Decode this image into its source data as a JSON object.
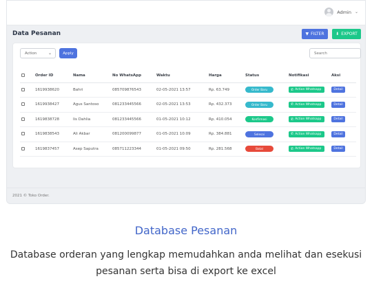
{
  "header": {
    "user_name": "Admin",
    "user_chevron": "⌄"
  },
  "page": {
    "title": "Data Pesanan",
    "filter_label": "FILTER",
    "export_label": "EXPORT"
  },
  "toolbar": {
    "action_value": "Action",
    "apply_label": "Apply",
    "search_placeholder": "Search"
  },
  "table": {
    "columns": [
      "Order ID",
      "Nama",
      "No WhatsApp",
      "Waktu",
      "Harga",
      "Status",
      "Notifikasi",
      "Aksi"
    ],
    "rows": [
      {
        "order_id": "1619938620",
        "nama": "Bahri",
        "wa": "085709876543",
        "waktu": "02-05-2021 13:57",
        "harga": "Rp. 63.749",
        "status": "Order Baru",
        "notif": "Action Whatsapp",
        "aksi": "Detail"
      },
      {
        "order_id": "1619938427",
        "nama": "Agus Santoso",
        "wa": "081233445566",
        "waktu": "02-05-2021 13:53",
        "harga": "Rp. 432.373",
        "status": "Order Baru",
        "notif": "Action Whatsapp",
        "aksi": "Detail"
      },
      {
        "order_id": "1619838728",
        "nama": "Iis Dahlia",
        "wa": "081233445566",
        "waktu": "01-05-2021 10:12",
        "harga": "Rp. 410.054",
        "status": "Konfirmasi",
        "notif": "Action Whatsapp",
        "aksi": "Detail"
      },
      {
        "order_id": "1619838543",
        "nama": "Ali Akbar",
        "wa": "081200099877",
        "waktu": "01-05-2021 10:09",
        "harga": "Rp. 384.881",
        "status": "Selesai",
        "notif": "Action Whatsapp",
        "aksi": "Detail"
      },
      {
        "order_id": "1619837457",
        "nama": "Asep Saputra",
        "wa": "085711223344",
        "waktu": "01-05-2021 09:50",
        "harga": "Rp. 281.568",
        "status": "Batal",
        "notif": "Action Whatsapp",
        "aksi": "Detail"
      }
    ]
  },
  "footer": {
    "text": "2021 © Toko Order."
  },
  "section": {
    "title": "Database Pesanan",
    "description": "Database orderan yang lengkap memudahkan anda melihat dan esekusi pesanan serta bisa di export ke excel"
  },
  "colors": {
    "primary": "#4e73df",
    "success": "#1cc88a",
    "info": "#36b9cc",
    "danger": "#e74a3b",
    "status_order_baru": "#36b9cc",
    "status_konfirmasi": "#1cc88a",
    "status_selesai": "#4e73df",
    "status_batal": "#e74a3b"
  }
}
